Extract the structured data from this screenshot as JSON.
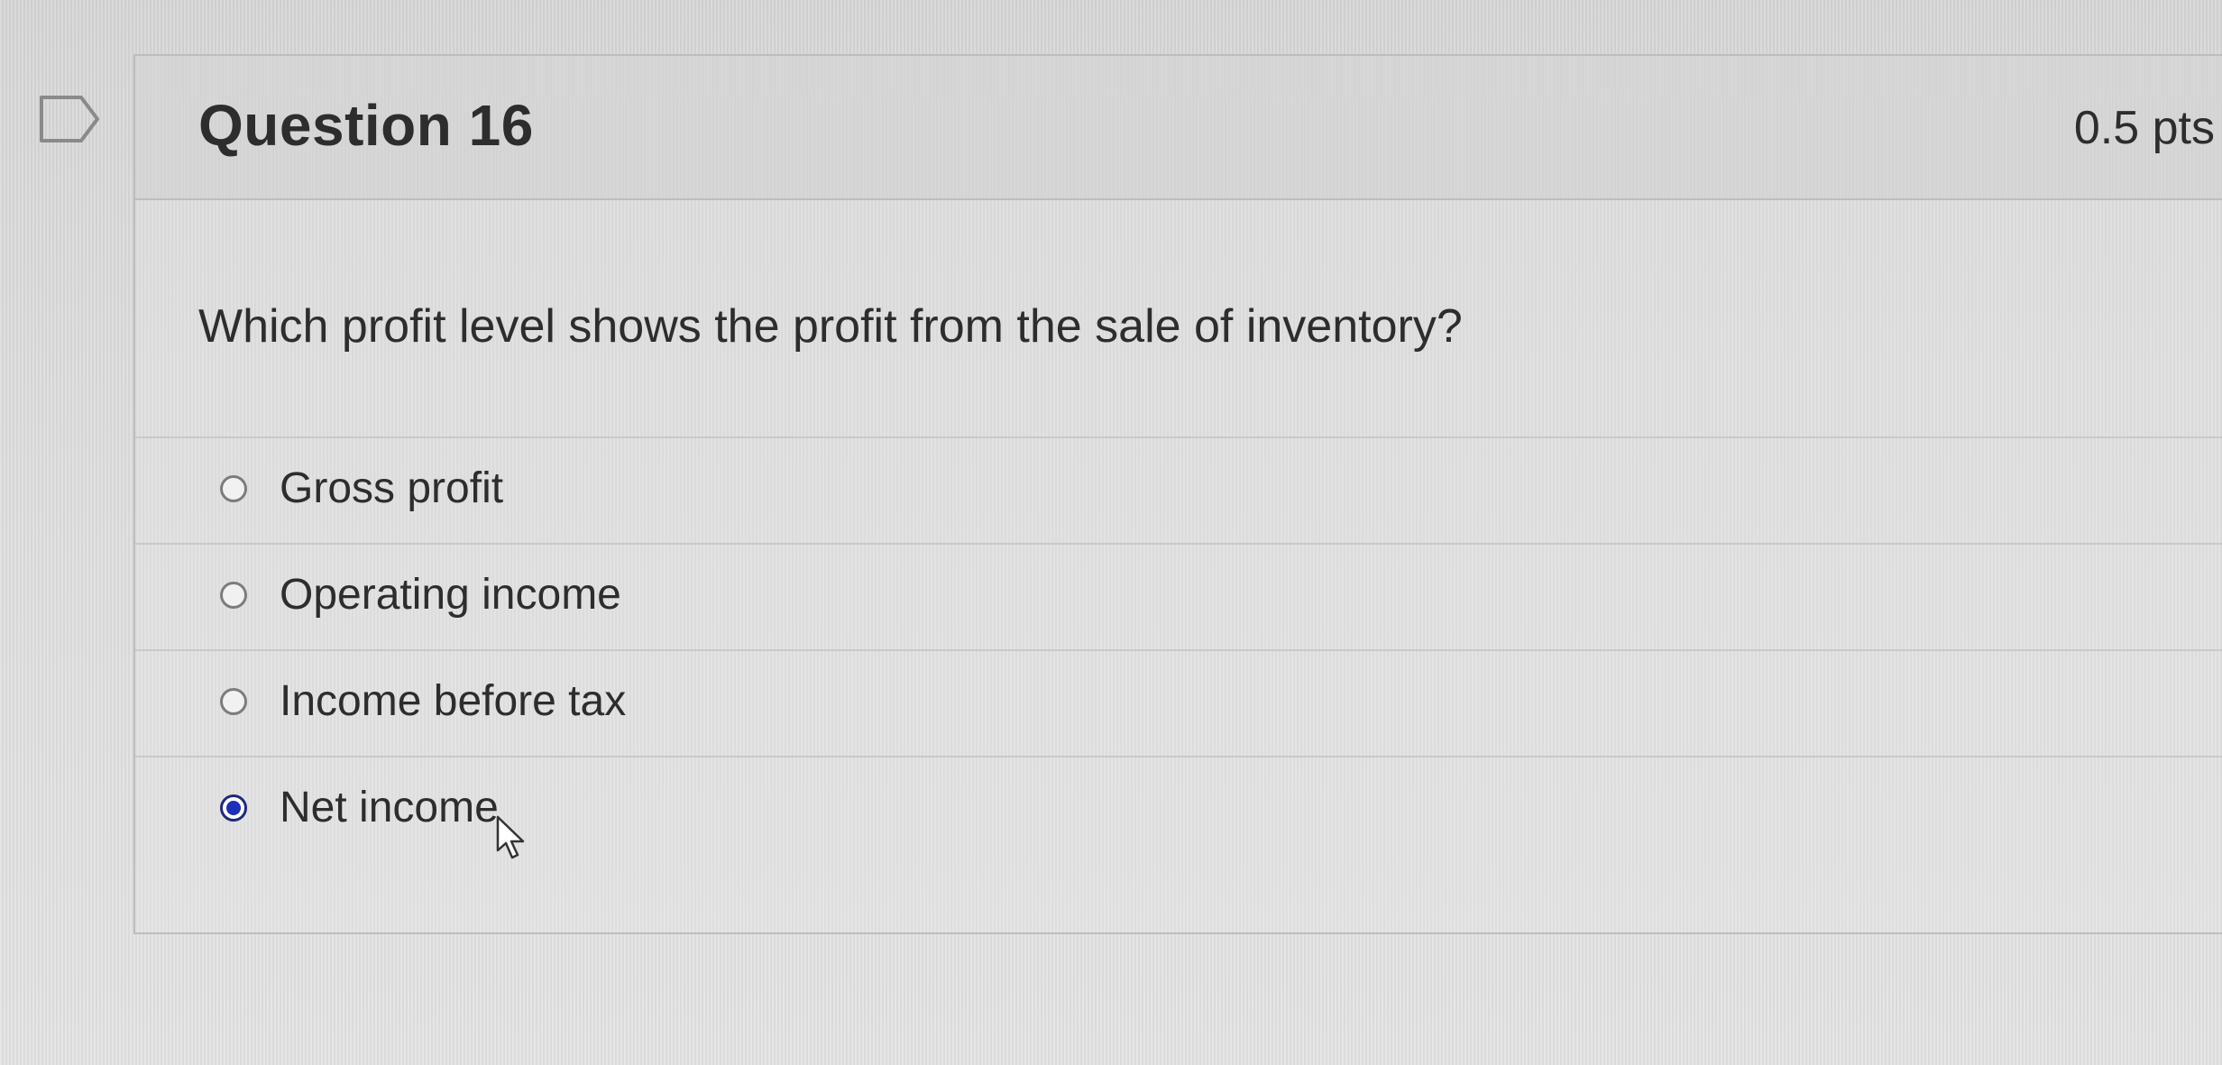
{
  "question": {
    "title": "Question 16",
    "points": "0.5 pts",
    "text": "Which profit level shows the profit from the sale of inventory?"
  },
  "answers": [
    {
      "label": "Gross profit",
      "selected": false
    },
    {
      "label": "Operating income",
      "selected": false
    },
    {
      "label": "Income before tax",
      "selected": false
    },
    {
      "label": "Net income",
      "selected": true
    }
  ],
  "icons": {
    "flag": "flag-question-icon",
    "cursor": "mouse-pointer-icon"
  },
  "colors": {
    "selected_radio": "#1b2fb8",
    "text": "#2d2d2d"
  }
}
